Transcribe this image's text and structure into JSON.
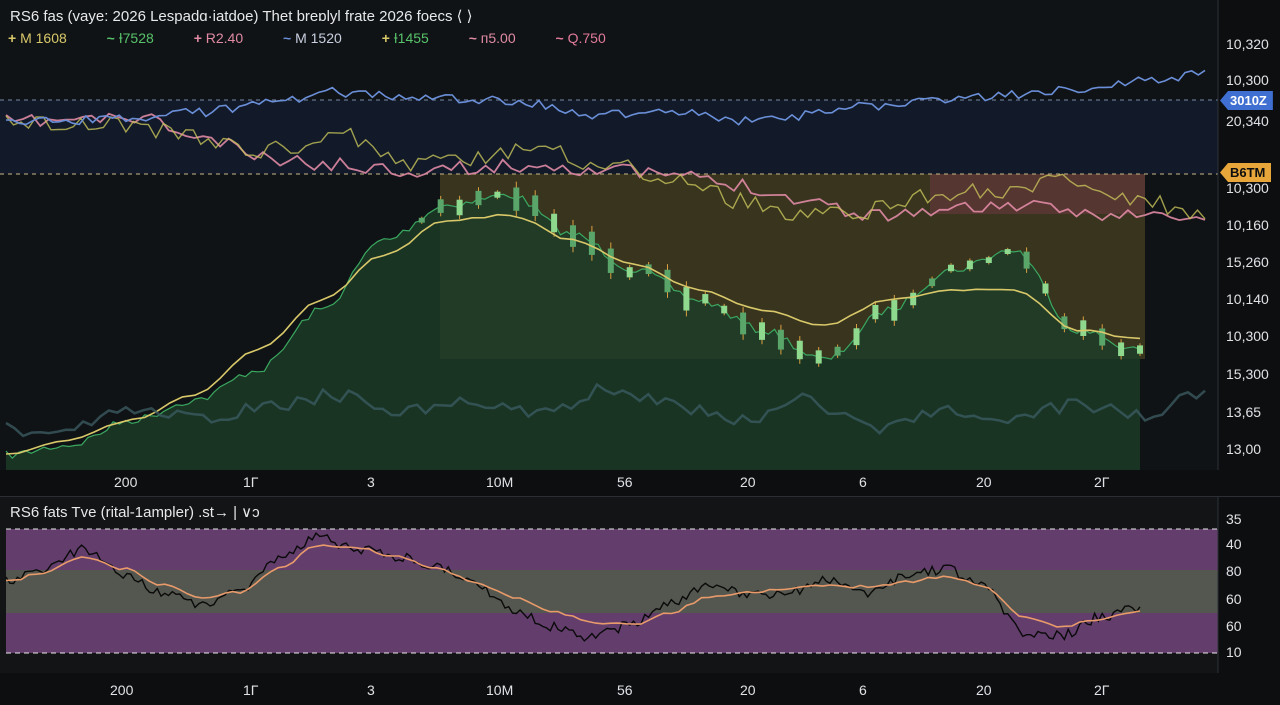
{
  "main": {
    "title": "RS6 fas (vaye: 2026 Lespadɑ·iatdoe) Thet breɒlyl frate 2026 foecs ⟨ ⟩",
    "legend": [
      {
        "label": "M 1608",
        "color": "#d8c86a"
      },
      {
        "label": "Ɨ7528",
        "color": "#58c26a"
      },
      {
        "label": "R2.40",
        "color": "#e08aa4"
      },
      {
        "label": "M 1520",
        "color": "#6a8fd8"
      },
      {
        "label": "Ɨ1455",
        "color": "#d8c86a"
      },
      {
        "label": "ᴨ5.00",
        "color": "#e08aa4"
      },
      {
        "label": "Q.750",
        "color": "#e07a9a"
      }
    ],
    "y_labels": [
      "10,320",
      "10,300",
      "20,340",
      "10,300",
      "10,160",
      "15,260",
      "10,140",
      "10,300",
      "15,300",
      "13,65",
      "13,00"
    ],
    "price_markers": [
      {
        "label": "3010Z",
        "color": "#3f6fd0"
      },
      {
        "label": "B6TM",
        "color": "#e8a53a"
      }
    ]
  },
  "x_labels": [
    "200",
    "1Γ",
    "3",
    "10M",
    "56",
    "20",
    "6",
    "20",
    "2Γ"
  ],
  "rsi": {
    "title": "RS6 fats Tve (ritаl-1ampler) .st→ | ∨ɔ",
    "y_labels": [
      "35",
      "40",
      "80",
      "60",
      "60",
      "10"
    ]
  },
  "colors": {
    "candle_up": "#8fd98f",
    "candle_wick": "#d8a040",
    "ma_fast": "#d8c86a",
    "ma_slow": "#e08aa4",
    "ma_blue": "#6a8fd8",
    "rsi_line": "#0a0a0a",
    "rsi_signal": "#e89a6a",
    "band_purple": "#9a5aa8",
    "band_gray": "#8a8e80"
  },
  "chart_data": [
    {
      "type": "line",
      "title": "RS6 fas (vaye: 2026 Lespadɑ·iatdoe) Thet breɒlyl frate 2026 foecs ⟨ ⟩",
      "categories": [
        "200",
        "1Γ",
        "3",
        "10M",
        "56",
        "20",
        "6",
        "20",
        "2Γ"
      ],
      "series": [
        {
          "name": "M 1520",
          "values": [
            10230,
            10240,
            10270,
            10300,
            10265,
            10250,
            10210,
            10300,
            10310
          ]
        },
        {
          "name": "R2.40",
          "values": [
            10240,
            10220,
            10200,
            10190,
            10180,
            10170,
            10160,
            10150,
            10160
          ]
        },
        {
          "name": "Ɨ7528",
          "values": [
            13000,
            13200,
            10300,
            10280,
            15260,
            10140,
            15300,
            10160,
            10300
          ]
        }
      ],
      "grid": true,
      "legend": "top-left"
    },
    {
      "type": "line",
      "title": "RS6 fats Tve (ritаl-1ampler) .st→ | ∨ɔ",
      "categories": [
        "200",
        "1Γ",
        "3",
        "10M",
        "56",
        "20",
        "6",
        "20",
        "2Γ"
      ],
      "series": [
        {
          "values": [
            80,
            60,
            42,
            75,
            45,
            20,
            68,
            80,
            40
          ]
        },
        {
          "values": [
            80,
            55,
            45,
            70,
            60,
            30,
            62,
            70,
            45
          ]
        }
      ],
      "y_ticks": [
        "35",
        "40",
        "80",
        "60",
        "60",
        "10"
      ]
    }
  ]
}
